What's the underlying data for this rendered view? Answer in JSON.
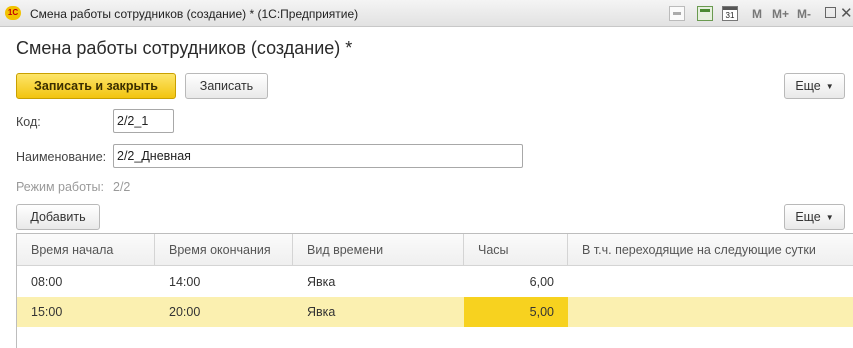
{
  "window": {
    "logo": "1С",
    "title": "Смена работы сотрудников (создание) * (1С:Предприятие)",
    "calendar_day": "31",
    "toolbar_m": "M",
    "toolbar_m_plus": "M+",
    "toolbar_m_minus": "M-",
    "close": "✕"
  },
  "page": {
    "title": "Смена работы сотрудников (создание) *"
  },
  "toolbar": {
    "save_close_label": "Записать и закрыть",
    "save_label": "Записать",
    "more_label": "Еще"
  },
  "form": {
    "code_label": "Код:",
    "code_value": "2/2_1",
    "name_label": "Наименование:",
    "name_value": "2/2_Дневная",
    "mode_label": "Режим работы:",
    "mode_value": "2/2"
  },
  "table_toolbar": {
    "add_label": "Добавить",
    "more_label": "Еще"
  },
  "table": {
    "columns": [
      "Время начала",
      "Время окончания",
      "Вид времени",
      "Часы",
      "В т.ч. переходящие на следующие сутки"
    ],
    "rows": [
      [
        "08:00",
        "14:00",
        "Явка",
        "6,00",
        ""
      ],
      [
        "15:00",
        "20:00",
        "Явка",
        "5,00",
        ""
      ]
    ]
  },
  "colors": {
    "accent": "#f2c40f",
    "selected_row": "#fbf0b0",
    "active_cell": "#f7d21f"
  },
  "icons": [
    "app-logo-icon",
    "print-icon",
    "calculator-icon",
    "calendar-icon",
    "restore-icon",
    "close-icon",
    "dropdown-caret-icon"
  ]
}
